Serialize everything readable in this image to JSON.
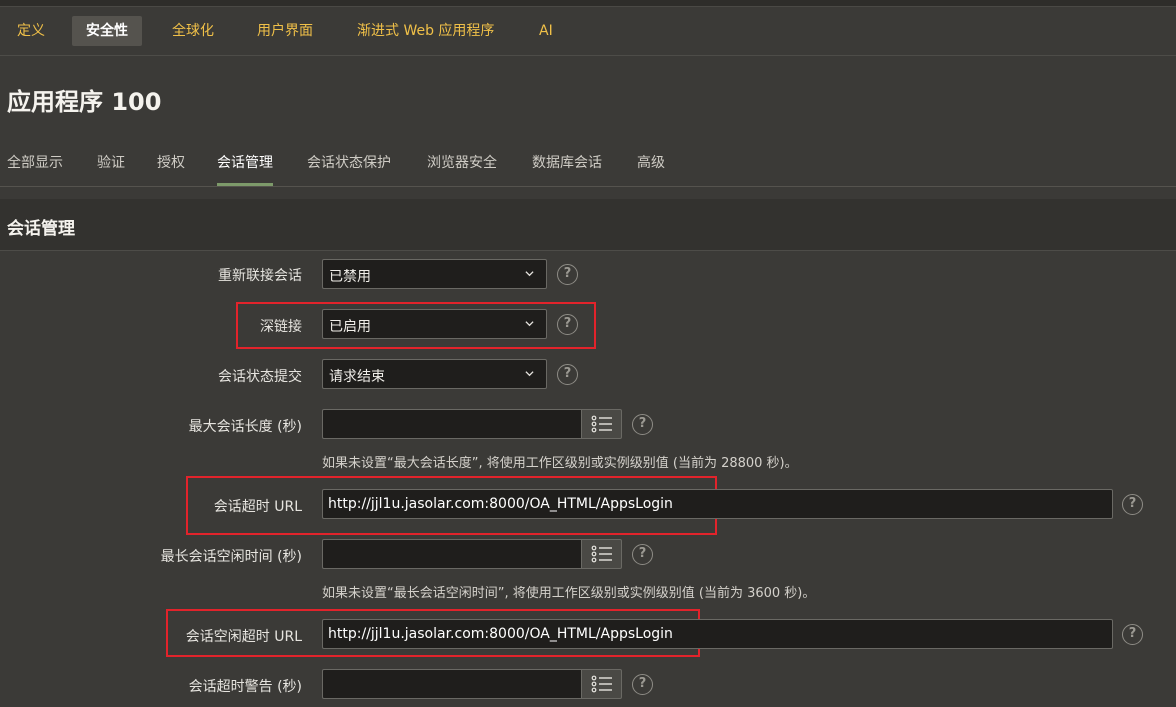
{
  "top_tabs": [
    "定义",
    "安全性",
    "全球化",
    "用户界面",
    "渐进式 Web 应用程序",
    "AI"
  ],
  "page_title": "应用程序 100",
  "sub_tabs": [
    "全部显示",
    "验证",
    "授权",
    "会话管理",
    "会话状态保护",
    "浏览器安全",
    "数据库会话",
    "高级"
  ],
  "section_title": "会话管理",
  "fields": {
    "rejoin": {
      "label": "重新联接会话",
      "value": "已禁用"
    },
    "deep_link": {
      "label": "深链接",
      "value": "已启用"
    },
    "state_commit": {
      "label": "会话状态提交",
      "value": "请求结束"
    },
    "max_length": {
      "label": "最大会话长度 (秒)",
      "value": "",
      "hint": "如果未设置“最大会话长度”, 将使用工作区级别或实例级别值 (当前为 28800 秒)。"
    },
    "timeout_url": {
      "label": "会话超时 URL",
      "value": "http://jjl1u.jasolar.com:8000/OA_HTML/AppsLogin"
    },
    "max_idle": {
      "label": "最长会话空闲时间 (秒)",
      "value": "",
      "hint": "如果未设置“最长会话空闲时间”, 将使用工作区级别或实例级别值 (当前为 3600 秒)。"
    },
    "idle_timeout_url": {
      "label": "会话空闲超时 URL",
      "value": "http://jjl1u.jasolar.com:8000/OA_HTML/AppsLogin"
    },
    "timeout_warning": {
      "label": "会话超时警告 (秒)",
      "value": ""
    }
  },
  "help_glyph": "?",
  "colors": {
    "accent": "#f0c048",
    "highlight_box": "#e2232b",
    "active_underline": "#7d9a6a"
  }
}
